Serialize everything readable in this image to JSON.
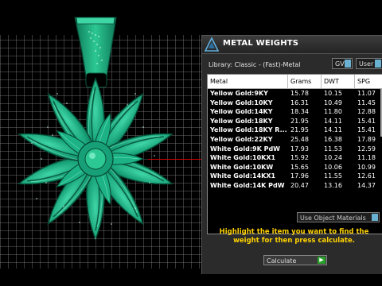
{
  "dialog": {
    "title": "METAL WEIGHTS",
    "library_label": "Library: Classic - (Fast)-Metal",
    "gv_toggle": "GV",
    "user_toggle": "User",
    "table": {
      "columns": [
        "Metal",
        "Grams",
        "DWT",
        "SPG"
      ],
      "rows": [
        [
          "Yellow Gold:9KY",
          "15.78",
          "10.15",
          "11.07"
        ],
        [
          "Yellow Gold:10KY",
          "16.31",
          "10.49",
          "11.45"
        ],
        [
          "Yellow Gold:14KY",
          "18.34",
          "11.80",
          "12.88"
        ],
        [
          "Yellow Gold:18KY",
          "21.95",
          "14.11",
          "15.41"
        ],
        [
          "Yellow Gold:18KY R...",
          "21.95",
          "14.11",
          "15.41"
        ],
        [
          "Yellow Gold:22KY",
          "25.48",
          "16.38",
          "17.89"
        ],
        [
          "White Gold:9K PdW",
          "17.93",
          "11.53",
          "12.59"
        ],
        [
          "White Gold:10KX1",
          "15.92",
          "10.24",
          "11.18"
        ],
        [
          "White Gold:10KW",
          "15.65",
          "10.06",
          "10.99"
        ],
        [
          "White Gold:14KX1",
          "17.96",
          "11.55",
          "12.61"
        ],
        [
          "White Gold:14K PdW",
          "20.47",
          "13.16",
          "14.37"
        ]
      ]
    },
    "use_materials": "Use Object Materials",
    "instruction": "Highlight the item you want to find the weight for then press calculate.",
    "calculate": "Calculate"
  },
  "colors": {
    "jewel": "#1aa37a",
    "highlight_text": "#ffd200",
    "axis": "#d40000"
  }
}
